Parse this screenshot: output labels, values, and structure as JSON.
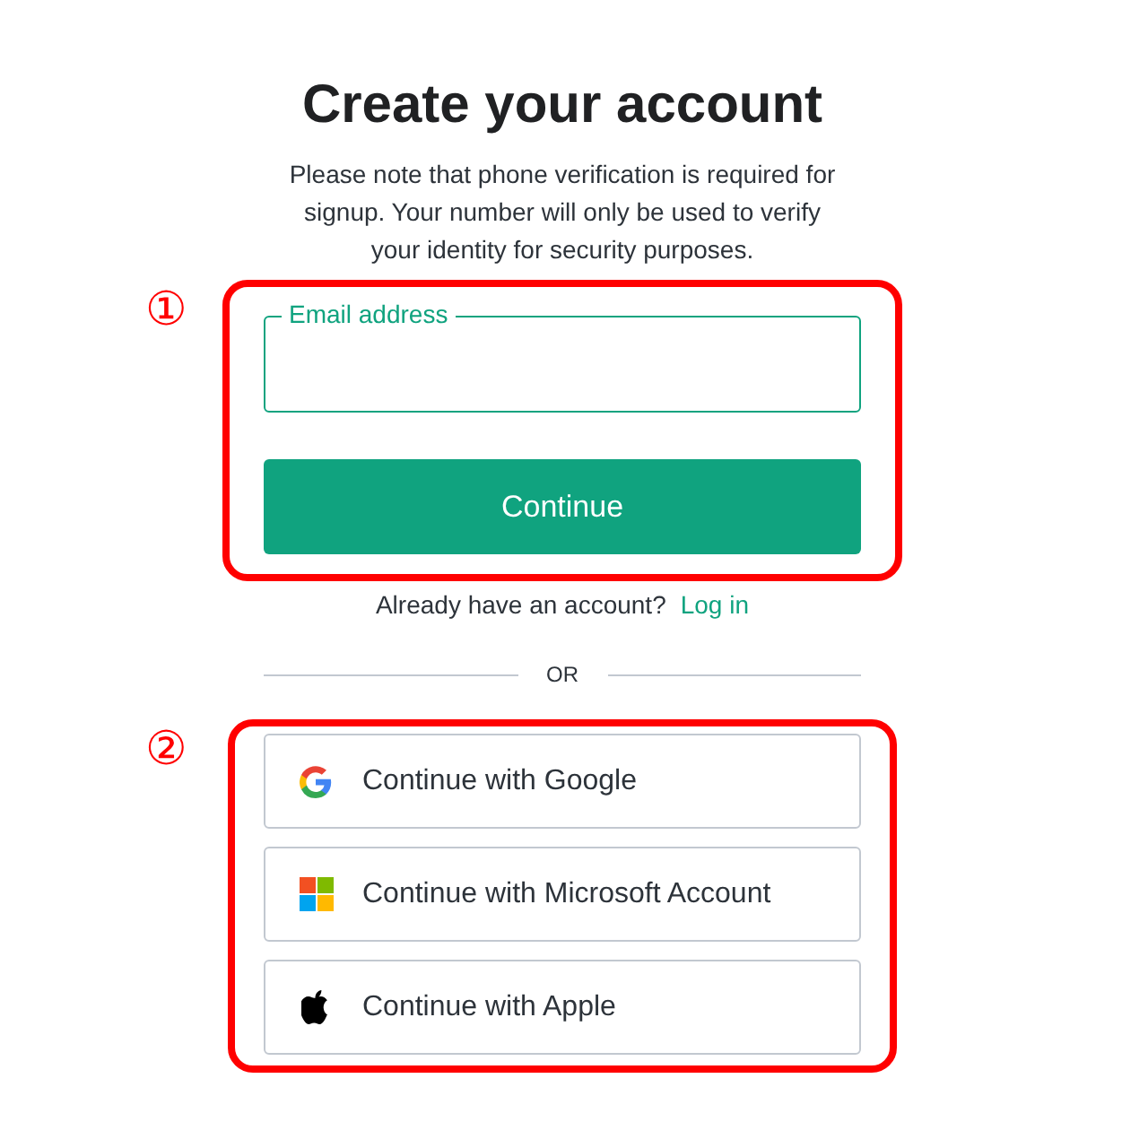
{
  "title": "Create your account",
  "notice": "Please note that phone verification is required for signup. Your number will only be used to verify your identity for security purposes.",
  "email_form": {
    "marker": "①",
    "field": {
      "label": "Email address"
    },
    "button": "Continue"
  },
  "login_prompt": {
    "text": "Already have an account?",
    "link": "Log in"
  },
  "divider": "OR",
  "social_login": {
    "marker": "②",
    "buttons": [
      {
        "kind": "google",
        "label": "Continue with Google"
      },
      {
        "kind": "microsoft",
        "label": "Continue with Microsoft Account"
      },
      {
        "kind": "apple",
        "label": "Continue with Apple"
      }
    ]
  }
}
